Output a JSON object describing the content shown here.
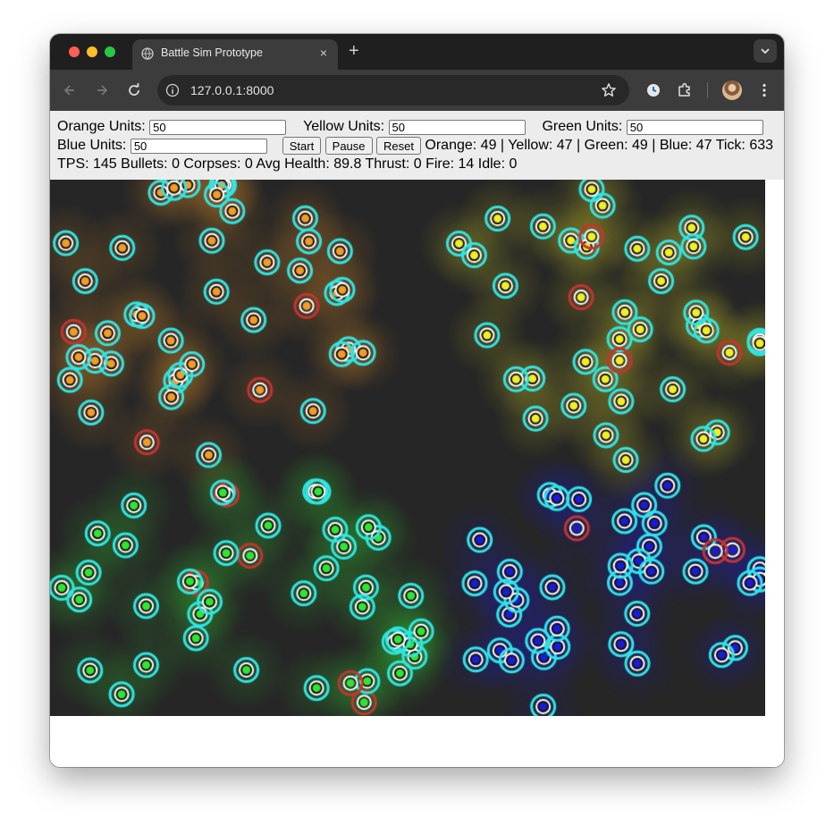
{
  "browser": {
    "tab_title": "Battle Sim Prototype",
    "url": "127.0.0.1:8000",
    "icons": {
      "favicon": "globe-icon",
      "tab_close": "close-icon",
      "new_tab": "plus-icon",
      "tab_search": "chevron-down-icon",
      "back": "arrow-left-icon",
      "forward": "arrow-right-icon",
      "reload": "reload-icon",
      "site_info": "info-icon",
      "bookmark": "star-icon",
      "extension_1": "password-manager-icon",
      "extensions": "puzzle-icon",
      "profile": "avatar",
      "menu": "kebab-menu-icon"
    },
    "tab_close_glyph": "×",
    "new_tab_glyph": "+"
  },
  "controls": {
    "orange_label": "Orange Units:",
    "orange_value": "50",
    "yellow_label": "Yellow Units:",
    "yellow_value": "50",
    "green_label": "Green Units:",
    "green_value": "50",
    "blue_label": "Blue Units:",
    "blue_value": "50",
    "start_label": "Start",
    "pause_label": "Pause",
    "reset_label": "Reset",
    "team_counts": "Orange: 49 | Yellow: 47 | Green: 49 | Blue: 47 Tick: 633",
    "stats": "TPS: 145 Bullets: 0 Corpses: 0 Avg Health: 89.8 Thrust: 0 Fire: 14 Idle: 0"
  },
  "simulation": {
    "background": "#262626",
    "teams": {
      "orange": "#f59a23",
      "yellow": "#f2ef1e",
      "green": "#2fe62f",
      "blue": "#1b1ad6"
    },
    "ring_color": "#2ee6e6",
    "dead_ring_color": "#c83232",
    "laser_color": "#e01010"
  }
}
